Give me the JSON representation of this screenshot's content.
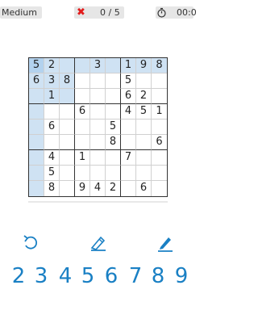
{
  "header": {
    "difficulty": "Medium",
    "errors": "0 / 5",
    "timer": "00:0"
  },
  "board": {
    "rows": [
      [
        "5",
        "2",
        "",
        "",
        "3",
        "",
        "1",
        "9",
        "8"
      ],
      [
        "6",
        "3",
        "8",
        "",
        "",
        "",
        "5",
        "",
        ""
      ],
      [
        "",
        "1",
        "",
        "",
        "",
        "",
        "6",
        "2",
        ""
      ],
      [
        "",
        "",
        "",
        "6",
        "",
        "",
        "4",
        "5",
        "1"
      ],
      [
        "",
        "6",
        "",
        "",
        "",
        "5",
        "",
        "",
        ""
      ],
      [
        "",
        "",
        "",
        "",
        "",
        "8",
        "",
        "",
        "6"
      ],
      [
        "",
        "4",
        "",
        "1",
        "",
        "",
        "7",
        "",
        ""
      ],
      [
        "",
        "5",
        "",
        "",
        "",
        "",
        "",
        "",
        ""
      ],
      [
        "",
        "8",
        "",
        "9",
        "4",
        "2",
        "",
        "6",
        ""
      ]
    ],
    "selected": [
      0,
      0
    ],
    "highlight_color": "#cfe2f3",
    "selected_color": "#b3d2ee"
  },
  "tools": {
    "undo_icon": "undo-icon",
    "erase_icon": "eraser-icon",
    "notes_icon": "pencil-icon",
    "accent": "#1a80c4"
  },
  "numpad": [
    "2",
    "3",
    "4",
    "5",
    "6",
    "7",
    "8",
    "9"
  ]
}
